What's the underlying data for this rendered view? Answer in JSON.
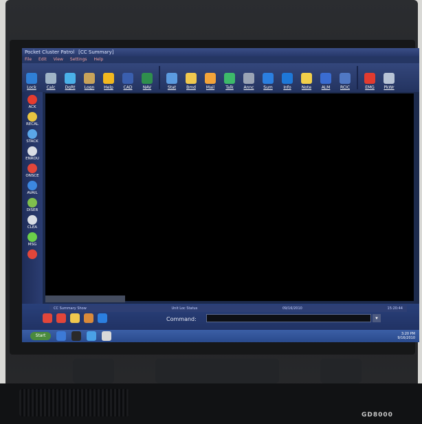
{
  "window": {
    "title": "Pocket Cluster Patrol",
    "title_tag": "[CC Summary]"
  },
  "menu": [
    "File",
    "Edit",
    "View",
    "Settings",
    "Help"
  ],
  "toolbar": [
    {
      "label": "Lock",
      "icon": "lock-icon",
      "color": "#2f7fd6"
    },
    {
      "label": "Calc",
      "icon": "calculator-icon",
      "color": "#9fb4c7"
    },
    {
      "label": "DgRt",
      "icon": "monitor-icon",
      "color": "#4ab0e8"
    },
    {
      "label": "Logn",
      "icon": "user-key-icon",
      "color": "#c8a35a"
    },
    {
      "label": "Help",
      "icon": "warning-icon",
      "color": "#f1b81f"
    },
    {
      "label": "CAD",
      "icon": "globe-icon",
      "color": "#3a5fae"
    },
    {
      "label": "NAV",
      "icon": "map-icon",
      "color": "#2f8f4d"
    },
    {
      "label": "Stat",
      "icon": "people-icon",
      "color": "#5b9be0"
    },
    {
      "label": "Bmd",
      "icon": "folder-icon",
      "color": "#f0c84e"
    },
    {
      "label": "Mail",
      "icon": "mail-icon",
      "color": "#f3a43a"
    },
    {
      "label": "Talk",
      "icon": "talk-icon",
      "color": "#3dba6a"
    },
    {
      "label": "Annc",
      "icon": "megaphone-icon",
      "color": "#9aa4b5"
    },
    {
      "label": "Sum",
      "icon": "summary-icon",
      "color": "#2b7fe0"
    },
    {
      "label": "Info",
      "icon": "info-icon",
      "color": "#1e78d8"
    },
    {
      "label": "Note",
      "icon": "note-icon",
      "color": "#f2d04a"
    },
    {
      "label": "ALM",
      "icon": "alarm-icon",
      "color": "#3a6cd1"
    },
    {
      "label": "RCIC",
      "icon": "radio-icon",
      "color": "#5078c4"
    },
    {
      "label": "EMG",
      "icon": "emergency-icon",
      "color": "#e23b2f"
    },
    {
      "label": "PkWr",
      "icon": "tools-icon",
      "color": "#b8c4d6"
    }
  ],
  "sidebar": [
    {
      "label": "ACK",
      "icon": "check-icon",
      "color": "#e63c2f"
    },
    {
      "label": "RECAL",
      "icon": "recall-icon",
      "color": "#e8c541"
    },
    {
      "label": "STACK",
      "icon": "stack-icon",
      "color": "#5aa6e8"
    },
    {
      "label": "ENROU",
      "icon": "car-icon",
      "color": "#d9dde4"
    },
    {
      "label": "ONSCE",
      "icon": "pin-icon",
      "color": "#e2463a"
    },
    {
      "label": "AVAIL",
      "icon": "available-icon",
      "color": "#3c88e0"
    },
    {
      "label": "DISER",
      "icon": "dispatch-icon",
      "color": "#7fbf4d"
    },
    {
      "label": "CLEA",
      "icon": "clear-icon",
      "color": "#d9dde4"
    },
    {
      "label": "MSG",
      "icon": "refresh-icon",
      "color": "#6ccf4a"
    },
    {
      "label": "",
      "icon": "pen-icon",
      "color": "#e2463a"
    }
  ],
  "status": {
    "left": "CC Summary Show",
    "unit": "Unit Loc Status",
    "date": "09/16/2010",
    "time": "15:20:44"
  },
  "command": {
    "label": "Command:",
    "value": ""
  },
  "quickbar": [
    {
      "icon": "envelope-icon",
      "color": "#e2463a"
    },
    {
      "icon": "record-icon",
      "color": "#e2463a"
    },
    {
      "icon": "person-icon",
      "color": "#f0c84e"
    },
    {
      "icon": "home-icon",
      "color": "#d98a3a"
    },
    {
      "icon": "info-icon",
      "color": "#2b7fe0"
    }
  ],
  "taskbar": {
    "start_label": "Start",
    "tray_time": "3:20 PM",
    "tray_date": "9/16/2010"
  },
  "device": {
    "brand": "GD8000"
  }
}
